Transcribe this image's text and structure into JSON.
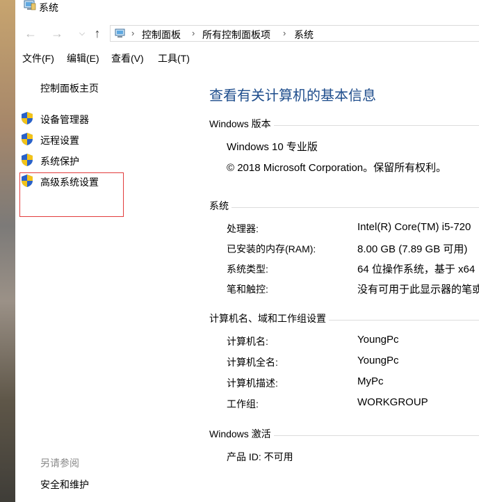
{
  "window": {
    "title": "系统"
  },
  "address_bar": {
    "breadcrumbs": [
      "控制面板",
      "所有控制面板项",
      "系统"
    ]
  },
  "menu": [
    {
      "label": "文件(F)"
    },
    {
      "label": "编辑(E)"
    },
    {
      "label": "查看(V)"
    },
    {
      "label": "工具(T)"
    }
  ],
  "sidebar": {
    "home": "控制面板主页",
    "items": [
      {
        "label": "设备管理器",
        "icon": "uac-shield-icon"
      },
      {
        "label": "远程设置",
        "icon": "uac-shield-icon"
      },
      {
        "label": "系统保护",
        "icon": "uac-shield-icon"
      },
      {
        "label": "高级系统设置",
        "icon": "uac-shield-icon"
      }
    ],
    "see_also_label": "另请参阅",
    "see_also_items": [
      "安全和维护"
    ],
    "highlight_color": "#e23b3b"
  },
  "main": {
    "title": "查看有关计算机的基本信息",
    "edition_section": {
      "heading": "Windows 版本",
      "edition": "Windows 10 专业版",
      "copyright": "© 2018 Microsoft Corporation。保留所有权利。"
    },
    "system_section": {
      "heading": "系统",
      "rows": [
        {
          "label": "处理器:",
          "value": "Intel(R) Core(TM) i5-720"
        },
        {
          "label": "已安装的内存(RAM):",
          "value": "8.00 GB (7.89 GB 可用)"
        },
        {
          "label": "系统类型:",
          "value": "64 位操作系统，基于 x64"
        },
        {
          "label": "笔和触控:",
          "value": "没有可用于此显示器的笔或"
        }
      ]
    },
    "computer_section": {
      "heading": "计算机名、域和工作组设置",
      "rows": [
        {
          "label": "计算机名:",
          "value": "YoungPc"
        },
        {
          "label": "计算机全名:",
          "value": "YoungPc"
        },
        {
          "label": "计算机描述:",
          "value": "MyPc"
        },
        {
          "label": "工作组:",
          "value": "WORKGROUP"
        }
      ]
    },
    "activation_section": {
      "heading": "Windows 激活",
      "product_id": "产品 ID: 不可用"
    }
  },
  "colors": {
    "title_blue": "#1e4d8c",
    "shield_blue": "#2a62c9",
    "shield_yellow": "#f3c318"
  }
}
